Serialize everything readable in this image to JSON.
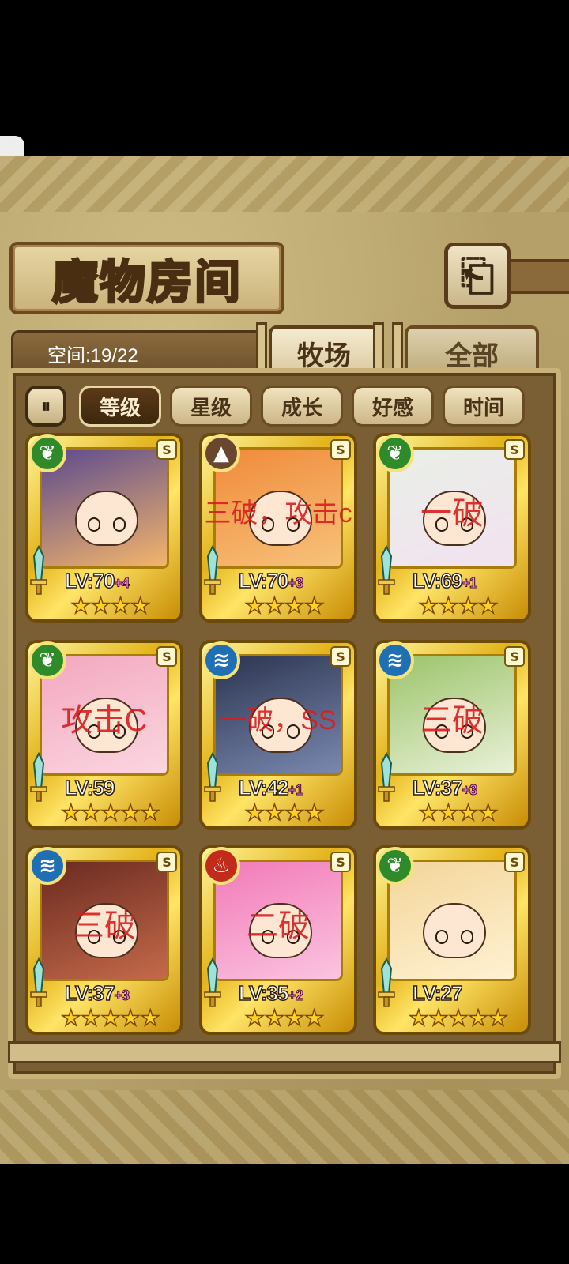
{
  "header": {
    "title": "魔物房间",
    "back_icon": "⎗"
  },
  "storage": {
    "label": "空间:19/22"
  },
  "tabs": [
    {
      "label": "牧场",
      "active": true
    },
    {
      "label": "全部",
      "active": false
    }
  ],
  "sort": {
    "toggle_icon": "⏸",
    "options": [
      {
        "label": "等级",
        "active": true
      },
      {
        "label": "星级",
        "active": false
      },
      {
        "label": "成长",
        "active": false
      },
      {
        "label": "好感",
        "active": false
      },
      {
        "label": "时间",
        "active": false
      }
    ]
  },
  "monsters": [
    {
      "element": "leaf",
      "element_color": "#2f8a2a",
      "element_glyph": "❦",
      "level": "LV:70",
      "plus": "+4",
      "stars": "★★★★",
      "note": "",
      "art": [
        "#5b4a8f",
        "#f4b56a"
      ]
    },
    {
      "element": "earth",
      "element_color": "#6a4630",
      "element_glyph": "▲",
      "level": "LV:70",
      "plus": "+3",
      "stars": "★★★★",
      "note": "三破，攻击c",
      "art": [
        "#f08a3a",
        "#f7c27a"
      ]
    },
    {
      "element": "leaf",
      "element_color": "#2f8a2a",
      "element_glyph": "❦",
      "level": "LV:69",
      "plus": "+1",
      "stars": "★★★★",
      "note": "一破",
      "art": [
        "#e8efe6",
        "#f3e2f0"
      ]
    },
    {
      "element": "leaf",
      "element_color": "#2f8a2a",
      "element_glyph": "❦",
      "level": "LV:59",
      "plus": "",
      "stars": "★★★★★",
      "note": "攻击C",
      "art": [
        "#f3a8bf",
        "#fbd6e0"
      ]
    },
    {
      "element": "water",
      "element_color": "#1f6fb5",
      "element_glyph": "≋",
      "level": "LV:42",
      "plus": "+1",
      "stars": "★★★★",
      "note": "一破，SS",
      "art": [
        "#2c3550",
        "#7a88b0"
      ]
    },
    {
      "element": "water",
      "element_color": "#1f6fb5",
      "element_glyph": "≋",
      "level": "LV:37",
      "plus": "+3",
      "stars": "★★★★",
      "note": "三破",
      "art": [
        "#9cc46a",
        "#e9f1d8"
      ]
    },
    {
      "element": "water",
      "element_color": "#1f6fb5",
      "element_glyph": "≋",
      "level": "LV:37",
      "plus": "+3",
      "stars": "★★★★★",
      "note": "三破",
      "art": [
        "#6a2a20",
        "#c46a4a"
      ]
    },
    {
      "element": "fire",
      "element_color": "#c22a1a",
      "element_glyph": "♨",
      "level": "LV:35",
      "plus": "+2",
      "stars": "★★★★",
      "note": "二破",
      "art": [
        "#f27ab8",
        "#fbc4e0"
      ]
    },
    {
      "element": "leaf",
      "element_color": "#2f8a2a",
      "element_glyph": "❦",
      "level": "LV:27",
      "plus": "",
      "stars": "★★★★★",
      "note": "",
      "art": [
        "#f3d59a",
        "#fff2d2"
      ]
    }
  ]
}
